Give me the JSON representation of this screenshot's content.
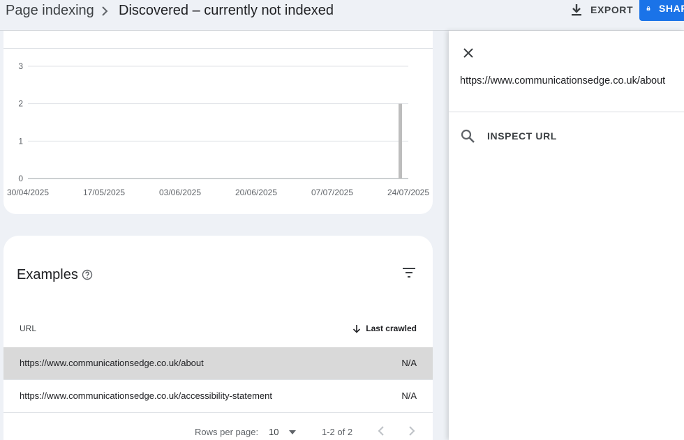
{
  "header": {
    "breadcrumb_root": "Page indexing",
    "breadcrumb_current": "Discovered – currently not indexed",
    "export_label": "EXPORT",
    "share_label": "SHARE"
  },
  "chart_data": {
    "type": "bar",
    "x": [
      "30/04/2025",
      "17/05/2025",
      "03/06/2025",
      "20/06/2025",
      "07/07/2025",
      "24/07/2025"
    ],
    "x_ticks": [
      "30/04/2025",
      "17/05/2025",
      "03/06/2025",
      "20/06/2025",
      "07/07/2025",
      "24/07/2025"
    ],
    "y_ticks": [
      0,
      1,
      2,
      3
    ],
    "ylim": [
      0,
      3
    ],
    "xlim": [
      "30/04/2025",
      "24/07/2025"
    ],
    "series": [
      {
        "points": [
          {
            "x": "24/07/2025",
            "y": 2
          }
        ]
      }
    ],
    "grid": true,
    "bar_color": "#bdbdbd"
  },
  "examples": {
    "title": "Examples",
    "columns": {
      "url": "URL",
      "last_crawled": "Last crawled"
    },
    "rows": [
      {
        "url": "https://www.communicationsedge.co.uk/about",
        "last_crawled": "N/A"
      },
      {
        "url": "https://www.communicationsedge.co.uk/accessibility-statement",
        "last_crawled": "N/A"
      }
    ],
    "pagination": {
      "rows_per_page_label": "Rows per page:",
      "rows_per_page_value": "10",
      "range": "1-2 of 2"
    }
  },
  "side_panel": {
    "url": "https://www.communicationsedge.co.uk/about",
    "inspect_label": "INSPECT URL"
  },
  "colors": {
    "accent": "#1a73e8",
    "selected_row": "#d9d9d9",
    "page_bg": "#eef1f6"
  }
}
